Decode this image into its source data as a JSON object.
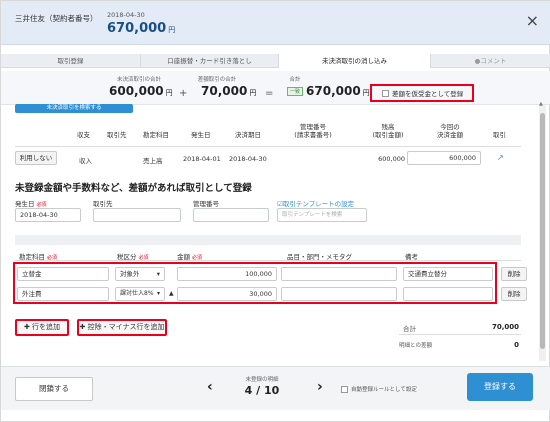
{
  "header": {
    "title": "三井住友（契約者番号）",
    "date": "2018-04-30",
    "amount": "670,000",
    "currency": "円",
    "close_glyph": "×"
  },
  "tabs": [
    {
      "label": "取引登録"
    },
    {
      "label": "口座振替・カード引き落とし"
    },
    {
      "label": "未決済取引の消し込み"
    },
    {
      "label": "●コメント"
    }
  ],
  "summary": {
    "unpaid_label": "未決済取引の合計",
    "unpaid_value": "600,000",
    "unregistered_label": "差額取引の合計",
    "unregistered_value": "70,000",
    "total_label": "合計",
    "total_badge": "一致",
    "total_value": "670,000",
    "plus": "+",
    "equals": "=",
    "currency": "円",
    "deposit_checkbox_label": "差額を仮受金として登録"
  },
  "search_link": "未決済取引を検索する",
  "table": {
    "headers": {
      "type": "収支",
      "partner": "取引先",
      "account": "勘定科目",
      "issue_date": "発生日",
      "due_date": "決済期日",
      "mgmt_no": "管理番号\n(請求書番号)",
      "balance": "残高\n(取引金額)",
      "settle": "今回の\n決済金額",
      "txn": "取引"
    },
    "row": {
      "use_button": "利用しない",
      "type": "収入",
      "account": "売上高",
      "issue_date": "2018-04-01",
      "due_date": "2018-04-30",
      "balance": "600,000",
      "settle_amount": "600,000"
    }
  },
  "section": {
    "title": "未登録金額や手数料など、差額があれば取引として登録",
    "issue_date_label": "発生日",
    "required": "必須",
    "partner_label": "取引先",
    "mgmt_label": "管理番号",
    "template_link": "☑取引テンプレートの設定",
    "issue_date_value": "2018-04-30",
    "template_placeholder": "取引テンプレートを検索",
    "col_account": "勘定科目",
    "col_tax": "税区分",
    "col_amount": "金額",
    "col_item": "品目・部門・メモタグ",
    "col_note": "備考"
  },
  "entries": [
    {
      "account": "立替金",
      "tax": "対象外",
      "amount": "100,000",
      "note": "交通費立替分",
      "delete": "削除"
    },
    {
      "account": "外注費",
      "tax": "課対仕入8%",
      "amount": "30,000",
      "note": "",
      "delete": "削除"
    }
  ],
  "actions": {
    "add_row": "✚ 行を追加",
    "add_deduction_row": "✚ 控除・マイナス行を追加"
  },
  "totals": {
    "total_label": "合計",
    "total_value": "70,000",
    "diff_label": "明細との差額",
    "diff_value": "0"
  },
  "footer": {
    "close_button": "閉鎖する",
    "pager_label": "未登録の明細",
    "pager_value": "4 / 10",
    "prev": "‹",
    "next": "›",
    "auto_rule_label": "自動登録ルールとして設定",
    "save_button": "登録する"
  },
  "colors": {
    "accent": "#2f8fd3",
    "highlight": "#e8001c",
    "header_bg": "#e3ecf6"
  }
}
